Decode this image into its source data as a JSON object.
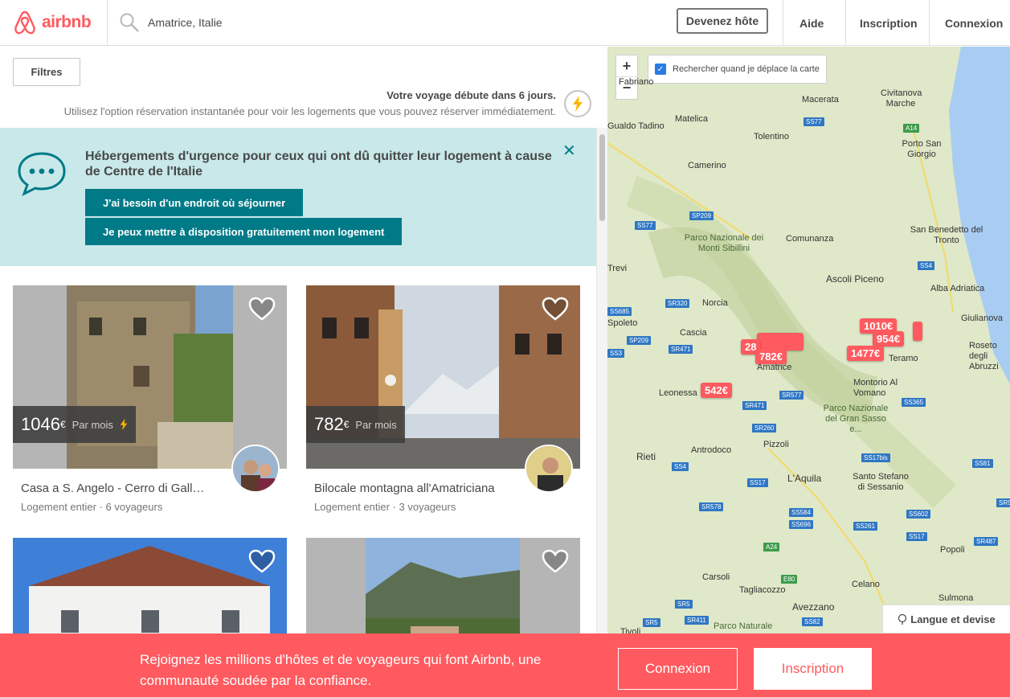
{
  "brand": {
    "name": "airbnb",
    "color": "#ff5a5f"
  },
  "header": {
    "search_value": "Amatrice, Italie",
    "host_label": "Devenez hôte",
    "help_label": "Aide",
    "signup_label": "Inscription",
    "login_label": "Connexion"
  },
  "filters": {
    "label": "Filtres"
  },
  "trip": {
    "title": "Votre voyage débute dans 6 jours.",
    "subtitle": "Utilisez l'option réservation instantanée pour voir les logements que vous pouvez réserver immédiatement."
  },
  "banner": {
    "title": "Hébergements d'urgence pour ceux qui ont dû quitter leur logement à cause de Centre de l'Italie",
    "btn_need": "J'ai besoin d'un endroit où séjourner",
    "btn_offer": "Je peux mettre à disposition gratuitement mon logement",
    "accent": "#007a87",
    "bg": "#c8e8e9"
  },
  "listings": [
    {
      "price": "1046",
      "currency": "€",
      "per": "Par mois",
      "instant": true,
      "title": "Casa a S. Angelo - Cerro di Gall…",
      "subtitle": "Logement entier · 6 voyageurs"
    },
    {
      "price": "782",
      "currency": "€",
      "per": "Par mois",
      "instant": false,
      "title": "Bilocale montagna all'Amatriciana",
      "subtitle": "Logement entier · 3 voyageurs"
    },
    {
      "price": "",
      "currency": "",
      "per": "",
      "instant": false,
      "title": "",
      "subtitle": ""
    },
    {
      "price": "",
      "currency": "",
      "per": "",
      "instant": false,
      "title": "",
      "subtitle": ""
    }
  ],
  "map": {
    "search_toggle_label": "Rechercher quand je déplace la carte",
    "zoom_in": "+",
    "zoom_out": "−",
    "places": [
      "Fabriano",
      "Macerata",
      "Civitanova Marche",
      "Matelica",
      "Tolentino",
      "Gualdo Tadino",
      "Porto San Giorgio",
      "Camerino",
      "Parco Nazionale dei Monti Sibillini",
      "Comunanza",
      "San Benedetto del Tronto",
      "Trevi",
      "Ascoli Piceno",
      "Alba Adriatica",
      "Norcia",
      "Giulianova",
      "Spoleto",
      "Cascia",
      "Roseto degli Abruzzi",
      "Amatrice",
      "Leonessa",
      "Montorio Al Vomano",
      "Teramo",
      "Parco Nazionale del Gran Sasso e...",
      "Antrodoco",
      "Pizzoli",
      "Rieti",
      "L'Aquila",
      "Santo Stefano di Sessanio",
      "Popoli",
      "Carsoli",
      "Tagliacozzo",
      "Celano",
      "Sulmona",
      "Avezzano",
      "Tivoli",
      "Parco Naturale"
    ],
    "roads": [
      "SS77",
      "A14",
      "SP209",
      "SS77",
      "SS4",
      "SS685",
      "SR320",
      "SP209",
      "SR471",
      "SS3",
      "SR471",
      "SR577",
      "SS365",
      "SR260",
      "SS17bis",
      "SS4",
      "SS17",
      "SR578",
      "SS584",
      "SS696",
      "SS602",
      "SS81",
      "SR5",
      "SS261",
      "SS17",
      "SR487",
      "A24",
      "E80",
      "SR5",
      "SR5",
      "SR411",
      "SS82"
    ],
    "pins": [
      "1010€",
      "954€",
      "1477€",
      "28",
      "782€",
      "542€"
    ],
    "lang_label": "Langue et devise"
  },
  "footer": {
    "text": "Rejoignez les millions d'hôtes et de voyageurs qui font Airbnb, une communauté soudée par la confiance.",
    "login": "Connexion",
    "signup": "Inscription"
  }
}
